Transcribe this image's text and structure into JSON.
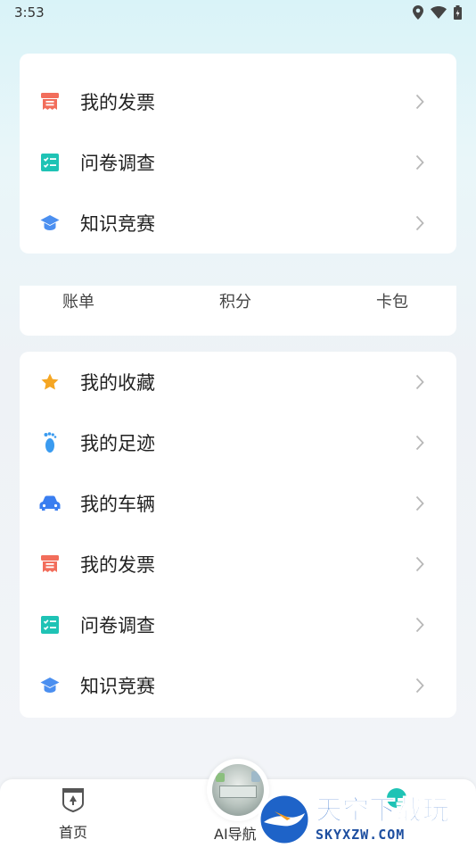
{
  "status": {
    "time": "3:53"
  },
  "card1": {
    "items": [
      {
        "label": "我的发票",
        "icon": "invoice-icon",
        "color": "#f26d5b"
      },
      {
        "label": "问卷调查",
        "icon": "survey-icon",
        "color": "#1fc3b5"
      },
      {
        "label": "知识竞赛",
        "icon": "graduation-cap-icon",
        "color": "#4b8ff0"
      }
    ]
  },
  "card2": {
    "tabs": [
      "账单",
      "积分",
      "卡包"
    ]
  },
  "card3": {
    "items": [
      {
        "label": "我的收藏",
        "icon": "star-icon",
        "color": "#f5a623"
      },
      {
        "label": "我的足迹",
        "icon": "footprint-icon",
        "color": "#3a9bf0"
      },
      {
        "label": "我的车辆",
        "icon": "car-icon",
        "color": "#3a7ef0"
      },
      {
        "label": "我的发票",
        "icon": "invoice-icon",
        "color": "#f26d5b"
      },
      {
        "label": "问卷调查",
        "icon": "survey-icon",
        "color": "#1fc3b5"
      },
      {
        "label": "知识竞赛",
        "icon": "graduation-cap-icon",
        "color": "#4b8ff0"
      }
    ]
  },
  "bottomnav": {
    "home_label": "首页",
    "ai_label": "AI导航"
  },
  "watermark": {
    "brand_cn": "天空下载玩",
    "brand_en": "SKYXZW.COM"
  }
}
